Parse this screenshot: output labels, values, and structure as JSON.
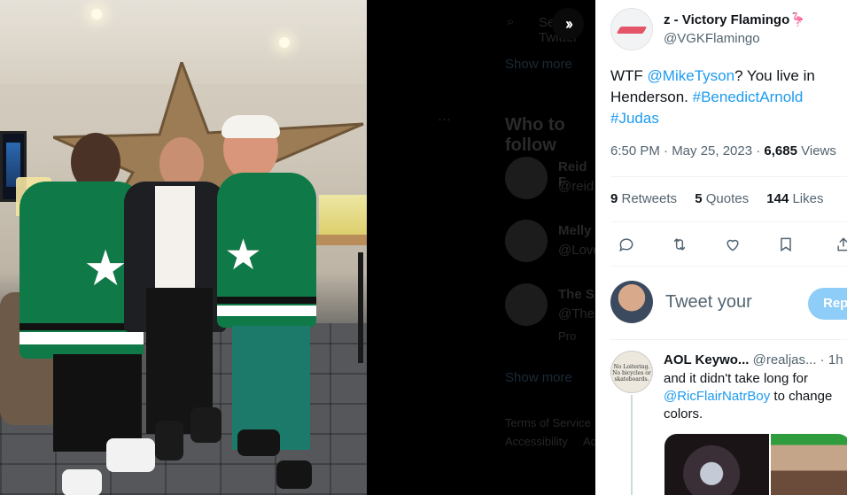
{
  "expand_icon": "chevron-double-right-icon",
  "dimmed_sidebar": {
    "search_placeholder": "Search Twitter",
    "show_more_top": "Show more",
    "who_to_follow": "Who to follow",
    "suggestions": [
      {
        "name": "Reid F",
        "handle": "@reid"
      },
      {
        "name": "Melly",
        "handle": "@Love"
      },
      {
        "name": "The S",
        "handle": "@The",
        "note": "Pro"
      }
    ],
    "show_more_bottom": "Show more",
    "footer": [
      "Terms of Service",
      "Accessibility",
      "Ad"
    ]
  },
  "tweet": {
    "author_name": "z - Victory Flamingo",
    "author_emoji": "🦩",
    "author_handle": "@VGKFlamingo",
    "text_parts": {
      "t1": "WTF ",
      "mention": "@MikeTyson",
      "t2": "? You live in Henderson. ",
      "hashtag1": "#BenedictArnold",
      "hashtag2": "#Judas"
    },
    "time": "6:50 PM · May 25, 2023 · ",
    "views_count": "6,685",
    "views_label": " Views",
    "retweets_count": "9",
    "retweets_label": " Retweets",
    "quotes_count": "5",
    "quotes_label": " Quotes",
    "likes_count": "144",
    "likes_label": " Likes"
  },
  "actions": [
    "reply-icon",
    "retweet-icon",
    "like-icon",
    "bookmark-icon",
    "share-icon"
  ],
  "reply_box": {
    "placeholder": "Tweet your",
    "button_label": "Rep"
  },
  "reply": {
    "name": "AOL Keywo...",
    "handle": "@realjas...",
    "time": " · 1h",
    "text1": "and it didn't take long for ",
    "mention": "@RicFlairNatrBoy",
    "text2": " to change colors.",
    "avatar_text": "No Loitering. No bicycles or skateboards."
  },
  "colors": {
    "accent": "#1d9bf0",
    "secondary_text": "#536471",
    "reply_button": "#8ecdf7",
    "jersey_green": "#0f7a47"
  }
}
